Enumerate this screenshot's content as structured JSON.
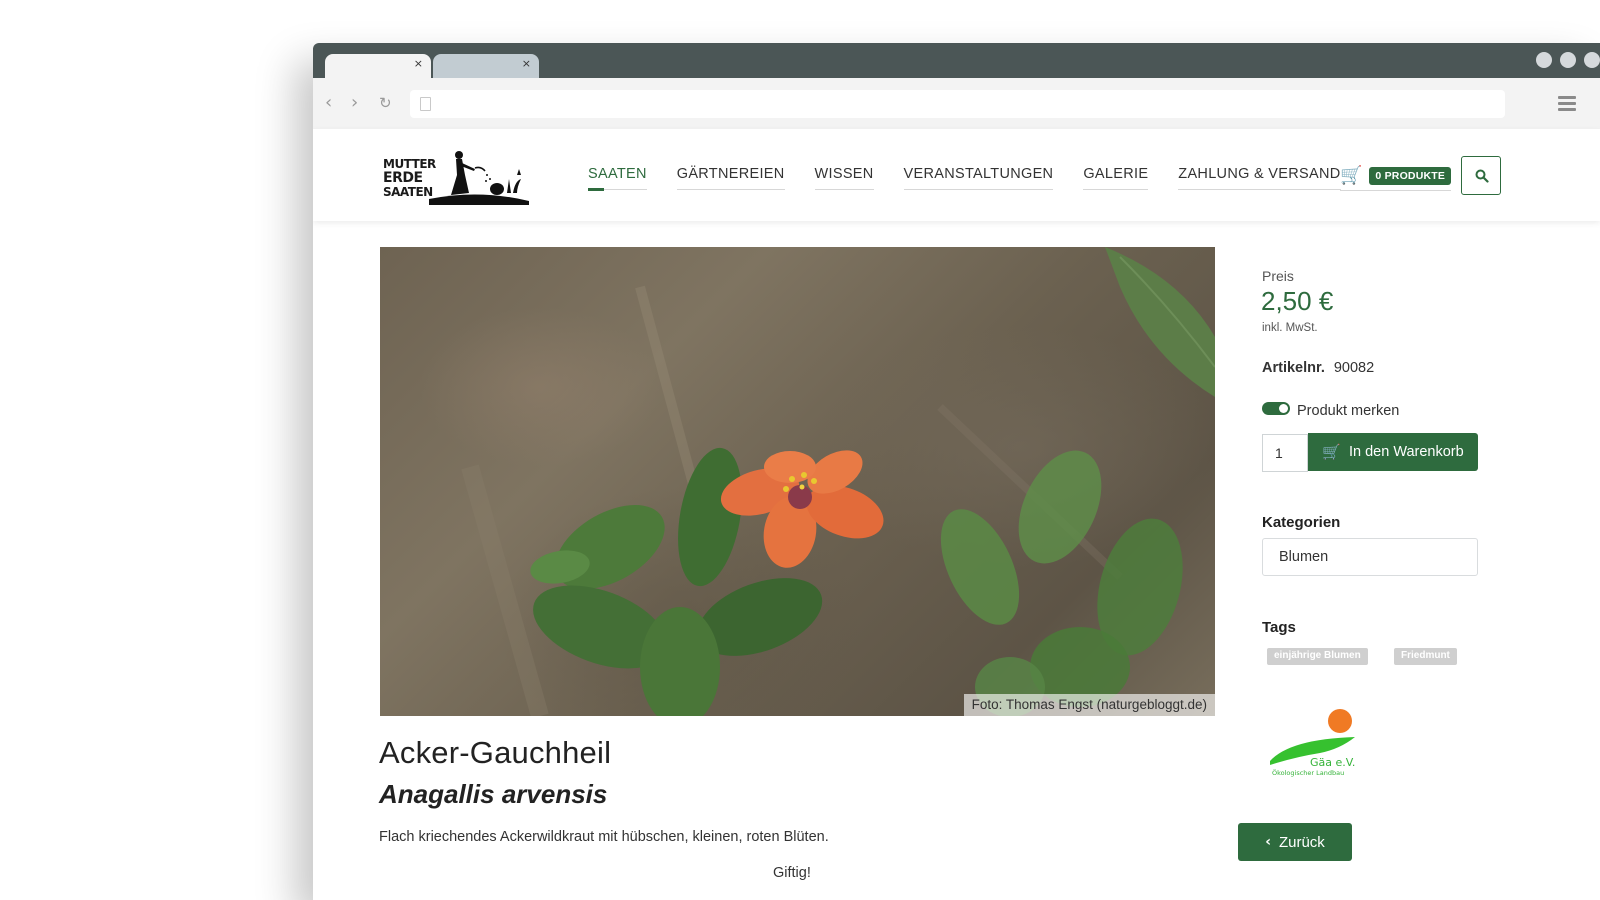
{
  "browser": {
    "tabs": [
      {
        "close": "×"
      },
      {
        "close": "×"
      }
    ]
  },
  "site": {
    "logo_lines": [
      "MUTTER",
      "ERDE",
      "SAATEN"
    ],
    "nav": [
      "SAATEN",
      "GÄRTNEREIEN",
      "WISSEN",
      "VERANSTALTUNGEN",
      "GALERIE",
      "ZAHLUNG & VERSAND"
    ],
    "nav_active": "SAATEN",
    "cart_label": "0 PRODUKTE",
    "accent_color": "#2e6b3e"
  },
  "product": {
    "photo_caption": "Foto: Thomas Engst (naturgebloggt.de)",
    "name": "Acker-Gauchheil",
    "latin_name": "Anagallis arvensis",
    "description": "Flach kriechendes Ackerwildkraut mit hübschen, kleinen, roten Blüten.",
    "note": "Giftig!",
    "price_label": "Preis",
    "price": "2,50 €",
    "vat_note": "inkl. MwSt.",
    "article_label": "Artikelnr.",
    "article_number": "90082",
    "remember_label": "Produkt merken",
    "remember_on": true,
    "quantity": "1",
    "add_to_cart_label": "In den Warenkorb",
    "categories_heading": "Kategorien",
    "category": "Blumen",
    "tags_heading": "Tags",
    "tags": [
      "einjährige Blumen",
      "Friedmunt"
    ],
    "certifier_name": "Gäa e.V.",
    "certifier_sub": "Ökologischer Landbau",
    "back_label": "Zurück"
  }
}
